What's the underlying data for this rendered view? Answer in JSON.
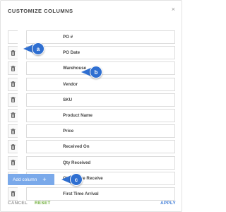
{
  "dialog": {
    "title": "CUSTOMIZE COLUMNS",
    "close_icon": "×"
  },
  "columns": [
    {
      "label": "PO #",
      "deletable": false
    },
    {
      "label": "PO Date",
      "deletable": true
    },
    {
      "label": "Warehouse",
      "deletable": true
    },
    {
      "label": "Vendor",
      "deletable": true
    },
    {
      "label": "SKU",
      "deletable": true
    },
    {
      "label": "Product Name",
      "deletable": true
    },
    {
      "label": "Price",
      "deletable": true
    },
    {
      "label": "Received On",
      "deletable": true
    },
    {
      "label": "Qty Received",
      "deletable": true
    },
    {
      "label": "Qty Before Receive",
      "deletable": true
    },
    {
      "label": "First Time Arrival",
      "deletable": true
    }
  ],
  "callouts": {
    "a": "a",
    "b": "b",
    "c": "c"
  },
  "actions": {
    "add_column_label": "Add column",
    "add_column_icon": "+",
    "cancel_label": "CANCEL",
    "reset_label": "RESET",
    "apply_label": "APPLY"
  },
  "colors": {
    "accent": "#3b7ad6",
    "callout": "#2f6fd1",
    "add_button": "#7aa9ea",
    "reset": "#6fae3a"
  },
  "icons": {
    "delete": "trash-icon",
    "close": "close-icon",
    "add": "plus-icon"
  }
}
